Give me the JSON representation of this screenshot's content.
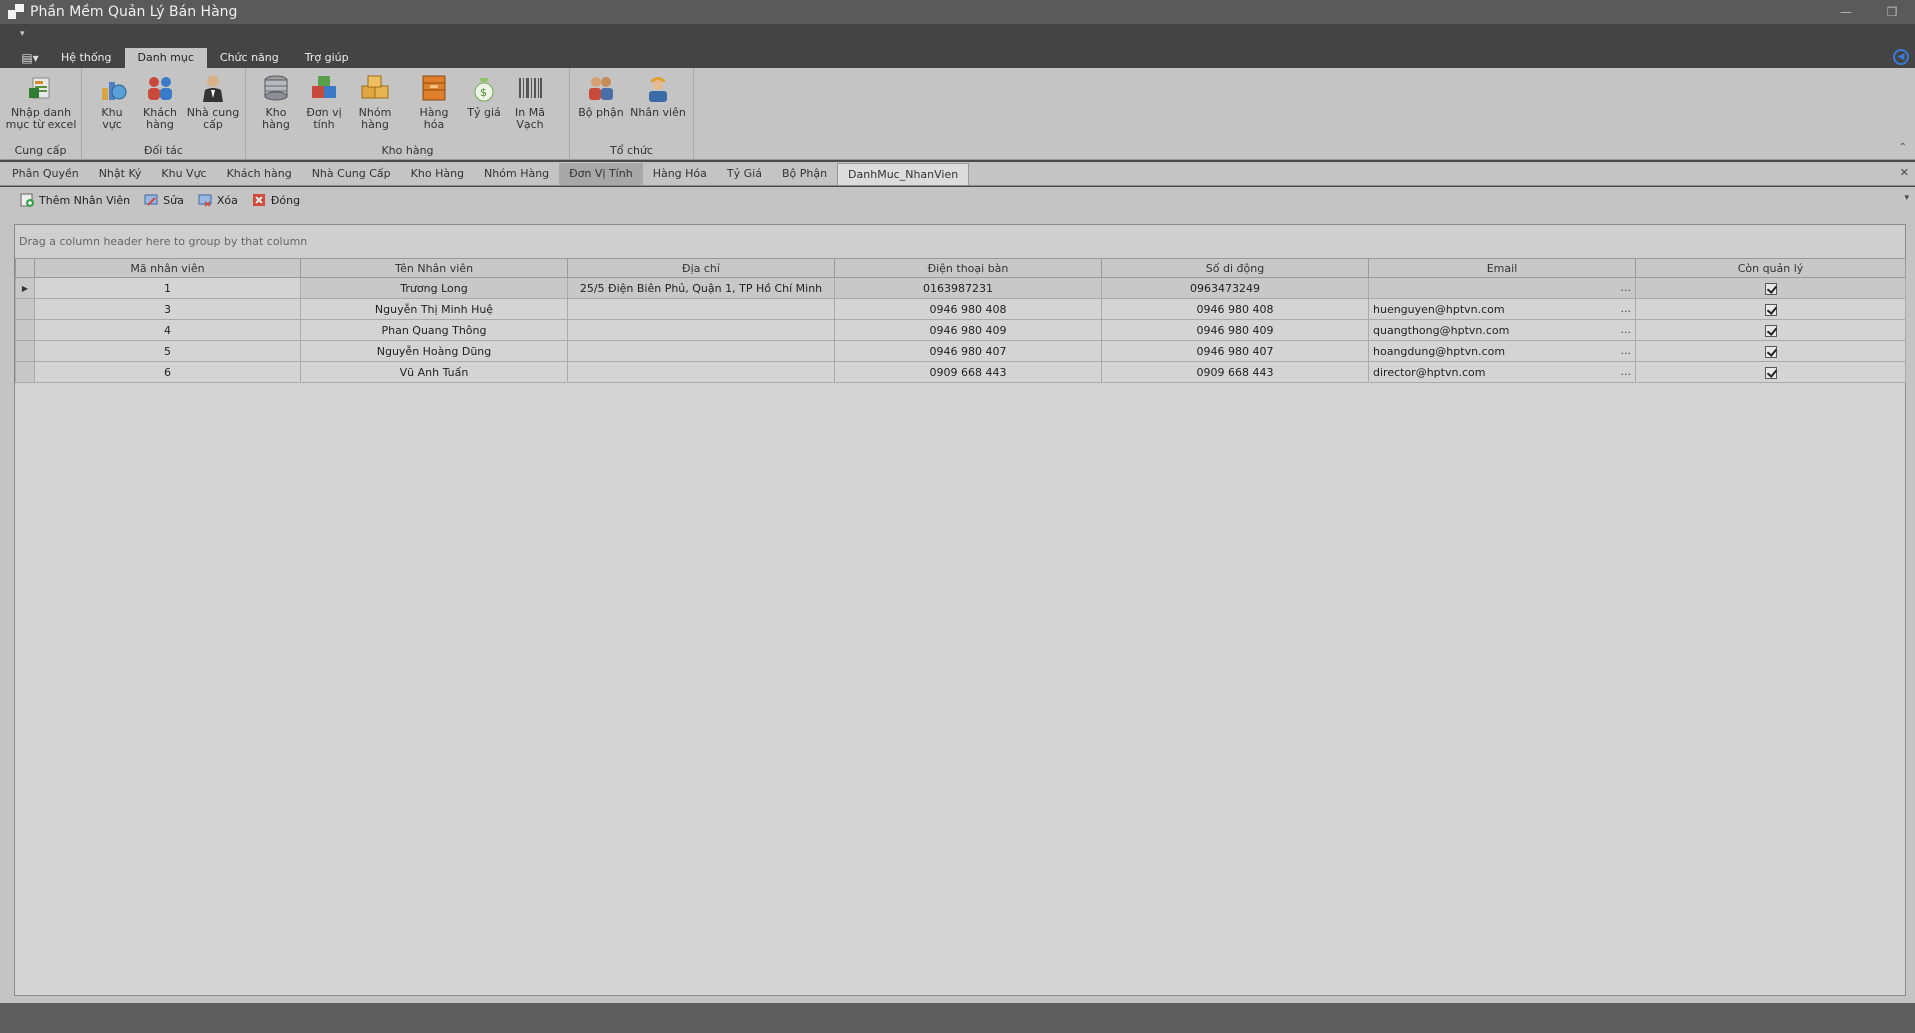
{
  "window": {
    "title": "Phần Mềm Quản Lý Bán Hàng",
    "controls": [
      "—",
      "❐"
    ]
  },
  "ribbon": {
    "tabs": [
      "Hệ thống",
      "Danh mục",
      "Chức năng",
      "Trợ giúp"
    ],
    "active_tab": "Danh mục",
    "groups": {
      "cung_cap": {
        "title": "Cung cấp",
        "buttons": [
          {
            "label1": "Nhập danh",
            "label2": "mục từ excel",
            "icon": "excel-import-icon"
          }
        ]
      },
      "doi_tac": {
        "title": "Đối tác",
        "buttons": [
          {
            "label1": "Khu vực",
            "label2": "",
            "icon": "region-icon"
          },
          {
            "label1": "Khách",
            "label2": "hàng",
            "icon": "customers-icon"
          },
          {
            "label1": "Nhà cung",
            "label2": "cấp",
            "icon": "supplier-icon"
          }
        ]
      },
      "kho_hang": {
        "title": "Kho hàng",
        "buttons": [
          {
            "label1": "Kho hàng",
            "label2": "",
            "icon": "warehouse-icon"
          },
          {
            "label1": "Đơn vị",
            "label2": "tính",
            "icon": "unit-icon"
          },
          {
            "label1": "Nhóm hàng",
            "label2": "",
            "icon": "product-group-icon"
          },
          {
            "label1": "Hàng hóa",
            "label2": "",
            "icon": "goods-icon"
          },
          {
            "label1": "Tỷ giá",
            "label2": "",
            "icon": "exchange-rate-icon"
          },
          {
            "label1": "In Mã",
            "label2": "Vạch",
            "icon": "barcode-icon"
          }
        ]
      },
      "to_chuc": {
        "title": "Tổ  chức",
        "buttons": [
          {
            "label1": "Bộ phận",
            "label2": "",
            "icon": "department-icon"
          },
          {
            "label1": "Nhân viên",
            "label2": "",
            "icon": "employee-icon"
          }
        ]
      }
    }
  },
  "doc_tabs": [
    "Phân Quyền",
    "Nhật Ký",
    "Khu Vực",
    "Khách hàng",
    "Nhà Cung Cấp",
    "Kho Hàng",
    "Nhóm Hàng",
    "Đơn Vị Tính",
    "Hàng Hóa",
    "Tỷ Giá",
    "Bộ Phận",
    "DanhMuc_NhanVien"
  ],
  "toolbar": {
    "add": "Thêm Nhân Viên",
    "edit": "Sửa",
    "delete": "Xóa",
    "close": "Đóng"
  },
  "grid": {
    "group_panel_text": "Drag a column header here to group by that column",
    "columns": [
      "Mã nhân viên",
      "Tên Nhân viên",
      "Địa chỉ",
      "Điện thoại bàn",
      "Số di động",
      "Email",
      "Còn quản lý"
    ],
    "rows": [
      {
        "id": "1",
        "name": "Trương Long",
        "address": "25/5 Điện Biên Phủ, Quận 1, TP Hồ Chí Minh",
        "phone": "0163987231",
        "mobile": "0963473249",
        "email": "",
        "active": true
      },
      {
        "id": "3",
        "name": "Nguyễn Thị Minh  Huệ",
        "address": "",
        "phone": "0946 980 408",
        "mobile": "0946 980 408",
        "email": "huenguyen@hptvn.com",
        "active": true
      },
      {
        "id": "4",
        "name": "Phan Quang Thông",
        "address": "",
        "phone": "0946 980 409",
        "mobile": "0946 980 409",
        "email": "quangthong@hptvn.com",
        "active": true
      },
      {
        "id": "5",
        "name": "Nguyễn Hoàng Dũng",
        "address": "",
        "phone": "0946 980 407",
        "mobile": "0946 980 407",
        "email": "hoangdung@hptvn.com",
        "active": true
      },
      {
        "id": "6",
        "name": "Vũ Anh Tuấn",
        "address": "",
        "phone": "0909 668 443",
        "mobile": "0909 668 443",
        "email": "director@hptvn.com",
        "active": true
      }
    ],
    "ellipsis": "..."
  },
  "colors": {
    "ribbon_bg": "#c4c4c4",
    "titlebar_bg": "#5a5a5a",
    "accent_blue": "#3a7bd5"
  }
}
